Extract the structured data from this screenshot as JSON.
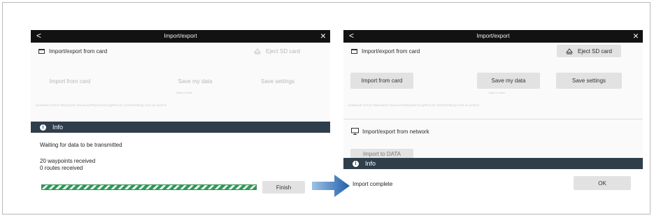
{
  "left_screen": {
    "title": "Import/export",
    "back_glyph": "<",
    "close_glyph": "×",
    "section_card": "Import/export from card",
    "eject_label": "Eject SD card",
    "buttons": {
      "import": "Import from card",
      "save_data": "Save my data",
      "save_settings": "Save settings"
    },
    "save_data_caption": "Data to Save",
    "fineprint": "Databank to/from Raymarine Navionics/Raymarine/Lighthouse charts/Settings sent as archive",
    "info_label": "Info",
    "status_message": "Waiting for data to be transmitted",
    "waypoints_line": "20 waypoints received",
    "routes_line": "0 routes received",
    "progress": 1.0,
    "finish_label": "Finish"
  },
  "right_screen": {
    "title": "Import/export",
    "back_glyph": "<",
    "close_glyph": "×",
    "section_card": "Import/export from card",
    "eject_label": "Eject SD card",
    "buttons": {
      "import": "Import from card",
      "save_data": "Save my data",
      "save_settings": "Save settings"
    },
    "save_data_caption": "Data to Save",
    "fineprint": "Databank to/from Raymarine Navionics/Raymarine/Lighthouse charts/Settings sent as archive",
    "section_network": "Import/export from network",
    "partial_button": "Import to DATA",
    "info_label": "Info",
    "complete_message": "Import complete",
    "ok_label": "OK"
  },
  "colors": {
    "titlebar": "#121212",
    "infobar": "#2f3e4b",
    "progress": "#2e9a5a",
    "arrow": "#1f5fa8"
  },
  "icons": {
    "back": "chevron-left-icon",
    "close": "close-icon",
    "card": "card-icon",
    "eject": "eject-icon",
    "network": "monitor-icon",
    "info": "info-icon",
    "arrow": "arrow-right-icon"
  }
}
